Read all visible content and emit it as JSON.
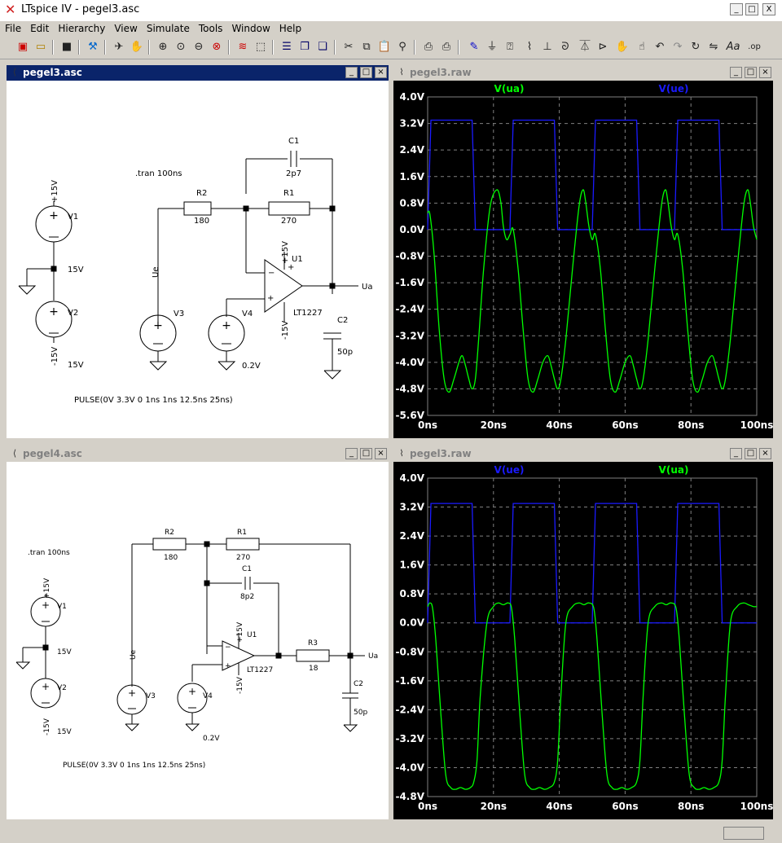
{
  "window": {
    "title": "LTspice IV - pegel3.asc",
    "minimize": "_",
    "maximize": "□",
    "close": "X"
  },
  "menu": [
    "File",
    "Edit",
    "Hierarchy",
    "View",
    "Simulate",
    "Tools",
    "Window",
    "Help"
  ],
  "toolbar": [
    "new-schematic",
    "open",
    "save",
    "control-panel",
    "run",
    "halt",
    "zoom-in",
    "pan",
    "zoom-out",
    "zoom-cancel",
    "autorange",
    "edit-text",
    "tile-horizontal",
    "cascade",
    "tile-vertical",
    "cut",
    "copy",
    "paste",
    "find",
    "print-setup",
    "print",
    "draw-wire",
    "ground",
    "label-net",
    "component",
    "resistor",
    "capacitor",
    "inductor",
    "diode",
    "move",
    "drag",
    "undo",
    "redo",
    "rotate",
    "mirror",
    "text",
    "spice-directive"
  ],
  "windows": {
    "sch1": {
      "title": "pegel3.asc",
      "icon": "⟨"
    },
    "plot1": {
      "title": "pegel3.raw",
      "icon": "⌇"
    },
    "sch2": {
      "title": "pegel4.asc",
      "icon": "⟨"
    },
    "plot2": {
      "title": "pegel3.raw",
      "icon": "⌇"
    }
  },
  "schematic1": {
    "directive": ".tran 100ns",
    "pulse": "PULSE(0V 3.3V 0 1ns 1ns 12.5ns 25ns)",
    "V1": "V1",
    "V1_val": "15V",
    "V2": "V2",
    "V2_val": "15V",
    "V3": "V3",
    "V4": "V4",
    "V4_val": "0.2V",
    "R1": "R1",
    "R1_val": "270",
    "R2": "R2",
    "R2_val": "180",
    "C1": "C1",
    "C1_val": "2p7",
    "C2": "C2",
    "C2_val": "50p",
    "U1": "U1",
    "U1_model": "LT1227",
    "pos15": "+15V",
    "neg15": "-15V",
    "net_ue": "Ue",
    "net_ua": "Ua"
  },
  "schematic2": {
    "directive": ".tran 100ns",
    "pulse": "PULSE(0V 3.3V 0 1ns 1ns 12.5ns 25ns)",
    "V1": "V1",
    "V1_val": "15V",
    "V2": "V2",
    "V2_val": "15V",
    "V3": "V3",
    "V4": "V4",
    "V4_val": "0.2V",
    "R1": "R1",
    "R1_val": "270",
    "R2": "R2",
    "R2_val": "180",
    "R3": "R3",
    "R3_val": "18",
    "C1": "C1",
    "C1_val": "8p2",
    "C2": "C2",
    "C2_val": "50p",
    "U1": "U1",
    "U1_model": "LT1227",
    "pos15": "+15V",
    "neg15": "-15V",
    "net_ue": "Ue",
    "net_ua": "Ua"
  },
  "colors": {
    "ua": "#00ff00",
    "ue": "#1a1aff",
    "grid": "#808080",
    "axis_text": "#ffffff",
    "bg": "#000000"
  },
  "chart_data": [
    {
      "type": "line",
      "legend_left": "V(ua)",
      "legend_right": "V(ue)",
      "xlim": [
        0,
        100
      ],
      "ylim": [
        -5.6,
        4.0
      ],
      "x_ticks": [
        "0ns",
        "20ns",
        "40ns",
        "60ns",
        "80ns",
        "100ns"
      ],
      "y_ticks": [
        "4.0V",
        "3.2V",
        "2.4V",
        "1.6V",
        "0.8V",
        "0.0V",
        "-0.8V",
        "-1.6V",
        "-2.4V",
        "-3.2V",
        "-4.0V",
        "-4.8V",
        "-5.6V"
      ],
      "series": [
        {
          "name": "V(ue)",
          "x": [
            0,
            1,
            13.5,
            14.5,
            25,
            26,
            38.5,
            39.5,
            50,
            51,
            63.5,
            64.5,
            75,
            76,
            88.5,
            89.5,
            100
          ],
          "y": [
            0,
            3.3,
            3.3,
            0,
            0,
            3.3,
            3.3,
            0,
            0,
            3.3,
            3.3,
            0,
            0,
            3.3,
            3.3,
            0,
            0
          ]
        },
        {
          "name": "V(ua)",
          "x": [
            0,
            0.7,
            2,
            3.5,
            5,
            6.5,
            8,
            9.5,
            10.5,
            11.5,
            12.5,
            13.5,
            14.5,
            15.5,
            17,
            19,
            21,
            22.2,
            23,
            24,
            25,
            26,
            27.5,
            29,
            30.5,
            32,
            33.5,
            35,
            36.5,
            37.5,
            38.5,
            39.5,
            40.5,
            42,
            44,
            46,
            47.2,
            48,
            49,
            50,
            51,
            52.5,
            54,
            55.5,
            57,
            58.5,
            60,
            61.5,
            62.5,
            63.5,
            64.5,
            65.5,
            67,
            69,
            71,
            72.2,
            73,
            74,
            75,
            76,
            77.5,
            79,
            80.5,
            82,
            83.5,
            85,
            86.5,
            87.5,
            88.5,
            89.5,
            90.5,
            92,
            94,
            96,
            97.2,
            98,
            99,
            100
          ],
          "y": [
            0.5,
            0.45,
            -0.8,
            -3,
            -4.5,
            -4.9,
            -4.5,
            -4,
            -3.8,
            -4.1,
            -4.5,
            -4.8,
            -4.5,
            -3.3,
            -1.2,
            0.7,
            1.2,
            0.85,
            0.1,
            -0.3,
            -0.15,
            0.0,
            -1.2,
            -3,
            -4.5,
            -4.9,
            -4.5,
            -4,
            -3.8,
            -4.1,
            -4.5,
            -4.8,
            -4.5,
            -3.3,
            -1.2,
            0.7,
            1.2,
            0.85,
            0.1,
            -0.3,
            -0.15,
            -1.2,
            -3,
            -4.5,
            -4.9,
            -4.5,
            -4,
            -3.8,
            -4.1,
            -4.5,
            -4.8,
            -4.5,
            -3.3,
            -1.2,
            0.7,
            1.2,
            0.85,
            0.1,
            -0.3,
            -0.15,
            -1.2,
            -3,
            -4.5,
            -4.9,
            -4.5,
            -4,
            -3.8,
            -4.1,
            -4.5,
            -4.8,
            -4.5,
            -3.3,
            -1.2,
            0.7,
            1.2,
            0.85,
            0.1,
            -0.3
          ]
        }
      ]
    },
    {
      "type": "line",
      "legend_left": "V(ue)",
      "legend_right": "V(ua)",
      "xlim": [
        0,
        100
      ],
      "ylim": [
        -4.8,
        4.0
      ],
      "x_ticks": [
        "0ns",
        "20ns",
        "40ns",
        "60ns",
        "80ns",
        "100ns"
      ],
      "y_ticks": [
        "4.0V",
        "3.2V",
        "2.4V",
        "1.6V",
        "0.8V",
        "0.0V",
        "-0.8V",
        "-1.6V",
        "-2.4V",
        "-3.2V",
        "-4.0V",
        "-4.8V"
      ],
      "series": [
        {
          "name": "V(ue)",
          "x": [
            0,
            1,
            13.5,
            14.5,
            25,
            26,
            38.5,
            39.5,
            50,
            51,
            63.5,
            64.5,
            75,
            76,
            88.5,
            89.5,
            100
          ],
          "y": [
            0,
            3.3,
            3.3,
            0,
            0,
            3.3,
            3.3,
            0,
            0,
            3.3,
            3.3,
            0,
            0,
            3.3,
            3.3,
            0,
            0
          ]
        },
        {
          "name": "V(ua)",
          "x": [
            0,
            0.7,
            1.5,
            2.5,
            4,
            5.5,
            7,
            8.5,
            10,
            11.5,
            13,
            14,
            15,
            16,
            18,
            20,
            21.5,
            23,
            24.5,
            25.5,
            26.5,
            28,
            29.5,
            31,
            32.5,
            34,
            35.5,
            37,
            38.5,
            39.5,
            40.5,
            42,
            44,
            46,
            47.5,
            49,
            50.5,
            51.5,
            53,
            54.5,
            56,
            57.5,
            59,
            60.5,
            62,
            63.5,
            64.5,
            65.5,
            67,
            69,
            71,
            72.5,
            74,
            75.5,
            76.5,
            78,
            79.5,
            81,
            82.5,
            84,
            85.5,
            87,
            88.5,
            89.5,
            90.5,
            92,
            94,
            96,
            97.5,
            99,
            100
          ],
          "y": [
            0.45,
            0.55,
            0.4,
            -0.5,
            -2.5,
            -4.2,
            -4.55,
            -4.6,
            -4.55,
            -4.6,
            -4.55,
            -4.4,
            -3.8,
            -2,
            0,
            0.45,
            0.55,
            0.5,
            0.55,
            0.4,
            -0.5,
            -2.5,
            -4.2,
            -4.55,
            -4.6,
            -4.55,
            -4.6,
            -4.55,
            -4.4,
            -3.8,
            -2,
            0,
            0.45,
            0.55,
            0.5,
            0.55,
            0.4,
            -0.5,
            -2.5,
            -4.2,
            -4.55,
            -4.6,
            -4.55,
            -4.6,
            -4.55,
            -4.4,
            -3.8,
            -2,
            0,
            0.45,
            0.55,
            0.5,
            0.55,
            0.4,
            -0.5,
            -2.5,
            -4.2,
            -4.55,
            -4.6,
            -4.55,
            -4.6,
            -4.55,
            -4.4,
            -3.8,
            -2,
            0,
            0.45,
            0.55,
            0.5,
            0.45,
            0.45
          ]
        }
      ]
    }
  ]
}
